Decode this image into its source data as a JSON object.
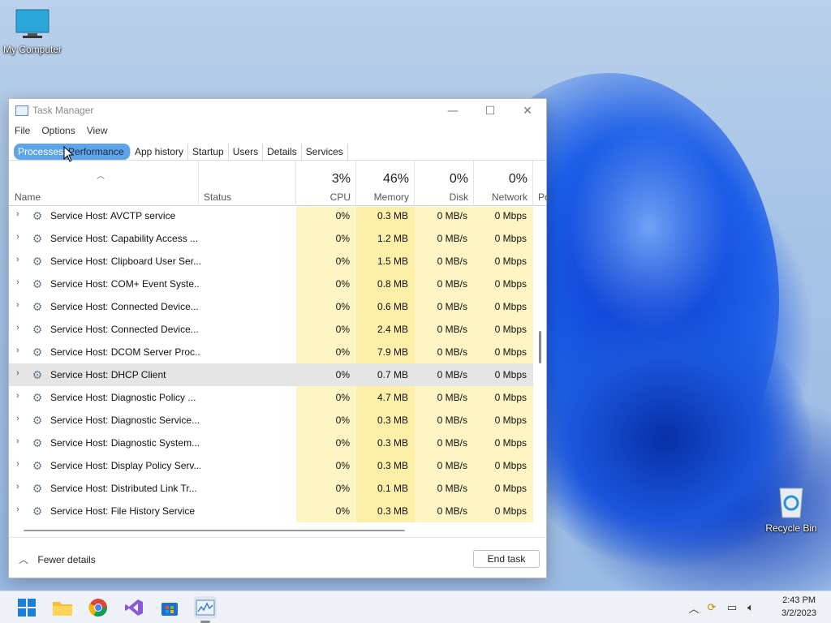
{
  "desktop": {
    "icons": [
      {
        "label": "My Computer"
      },
      {
        "label": "Recycle Bin"
      }
    ]
  },
  "window": {
    "title": "Task Manager",
    "controls": {
      "minimize": "—",
      "maximize": "☐",
      "close": "✕"
    },
    "menu": [
      "File",
      "Options",
      "View"
    ],
    "tabs": [
      "Processes",
      "Performance",
      "App history",
      "Startup",
      "Users",
      "Details",
      "Services"
    ],
    "columns": {
      "name": "Name",
      "status": "Status",
      "cpu": {
        "pct": "3%",
        "label": "CPU"
      },
      "memory": {
        "pct": "46%",
        "label": "Memory"
      },
      "disk": {
        "pct": "0%",
        "label": "Disk"
      },
      "network": {
        "pct": "0%",
        "label": "Network"
      },
      "power": "Po"
    },
    "rows": [
      {
        "name": "Service Host: AVCTP service",
        "cpu": "0%",
        "mem": "0.3 MB",
        "disk": "0 MB/s",
        "net": "0 Mbps"
      },
      {
        "name": "Service Host: Capability Access ...",
        "cpu": "0%",
        "mem": "1.2 MB",
        "disk": "0 MB/s",
        "net": "0 Mbps"
      },
      {
        "name": "Service Host: Clipboard User Ser...",
        "cpu": "0%",
        "mem": "1.5 MB",
        "disk": "0 MB/s",
        "net": "0 Mbps"
      },
      {
        "name": "Service Host: COM+ Event Syste...",
        "cpu": "0%",
        "mem": "0.8 MB",
        "disk": "0 MB/s",
        "net": "0 Mbps"
      },
      {
        "name": "Service Host: Connected Device...",
        "cpu": "0%",
        "mem": "0.6 MB",
        "disk": "0 MB/s",
        "net": "0 Mbps"
      },
      {
        "name": "Service Host: Connected Device...",
        "cpu": "0%",
        "mem": "2.4 MB",
        "disk": "0 MB/s",
        "net": "0 Mbps"
      },
      {
        "name": "Service Host: DCOM Server Proc...",
        "cpu": "0%",
        "mem": "7.9 MB",
        "disk": "0 MB/s",
        "net": "0 Mbps"
      },
      {
        "name": "Service Host: DHCP Client",
        "cpu": "0%",
        "mem": "0.7 MB",
        "disk": "0 MB/s",
        "net": "0 Mbps"
      },
      {
        "name": "Service Host: Diagnostic Policy ...",
        "cpu": "0%",
        "mem": "4.7 MB",
        "disk": "0 MB/s",
        "net": "0 Mbps"
      },
      {
        "name": "Service Host: Diagnostic Service...",
        "cpu": "0%",
        "mem": "0.3 MB",
        "disk": "0 MB/s",
        "net": "0 Mbps"
      },
      {
        "name": "Service Host: Diagnostic System...",
        "cpu": "0%",
        "mem": "0.3 MB",
        "disk": "0 MB/s",
        "net": "0 Mbps"
      },
      {
        "name": "Service Host: Display Policy Serv...",
        "cpu": "0%",
        "mem": "0.3 MB",
        "disk": "0 MB/s",
        "net": "0 Mbps"
      },
      {
        "name": "Service Host: Distributed Link Tr...",
        "cpu": "0%",
        "mem": "0.1 MB",
        "disk": "0 MB/s",
        "net": "0 Mbps"
      },
      {
        "name": "Service Host: File History Service",
        "cpu": "0%",
        "mem": "0.3 MB",
        "disk": "0 MB/s",
        "net": "0 Mbps"
      }
    ],
    "footer": {
      "fewer_details": "Fewer details",
      "end_task": "End task"
    }
  },
  "taskbar": {
    "clock": {
      "time": "2:43 PM",
      "date": "3/2/2023"
    }
  }
}
